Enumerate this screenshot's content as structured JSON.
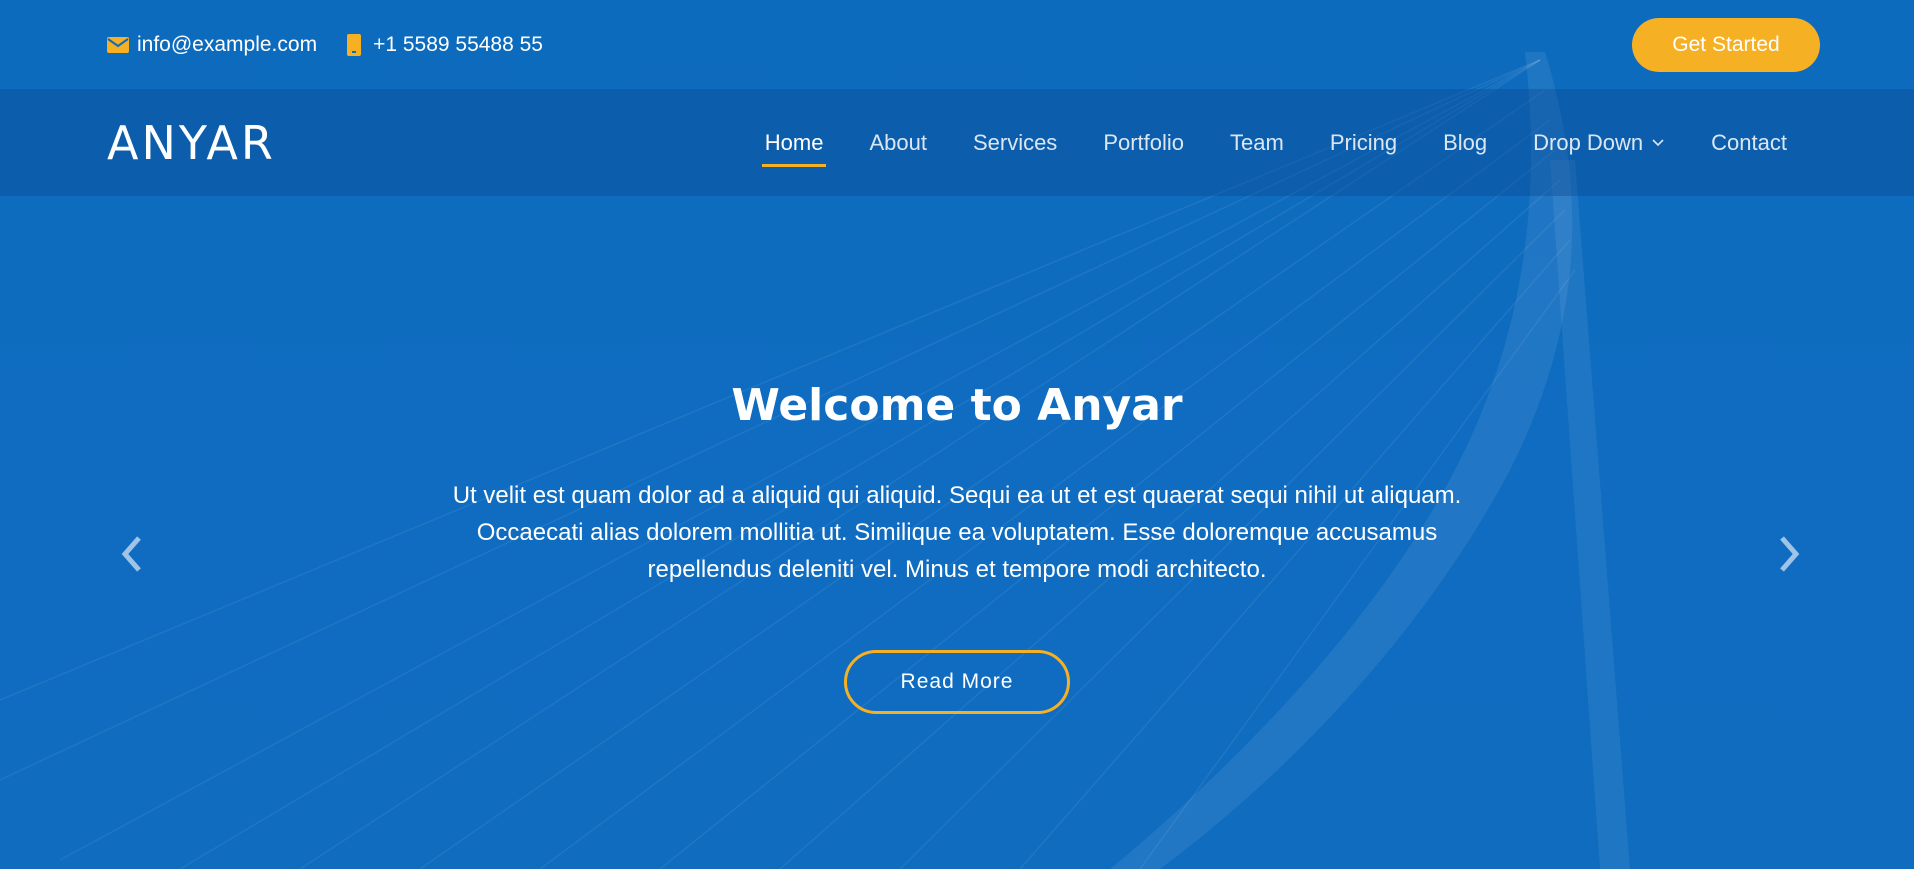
{
  "topbar": {
    "email": "info@example.com",
    "phone": "+1 5589 55488 55",
    "cta_label": "Get Started"
  },
  "header": {
    "logo": "ANYAR",
    "nav": [
      {
        "label": "Home",
        "active": true
      },
      {
        "label": "About"
      },
      {
        "label": "Services"
      },
      {
        "label": "Portfolio"
      },
      {
        "label": "Team"
      },
      {
        "label": "Pricing"
      },
      {
        "label": "Blog"
      },
      {
        "label": "Drop Down",
        "dropdown": true
      },
      {
        "label": "Contact"
      }
    ]
  },
  "hero": {
    "title": "Welcome to Anyar",
    "description": "Ut velit est quam dolor ad a aliquid qui aliquid. Sequi ea ut et est quaerat sequi nihil ut aliquam. Occaecati alias dolorem mollitia ut. Similique ea voluptatem. Esse doloremque accusamus repellendus deleniti vel. Minus et tempore modi architecto.",
    "button_label": "Read More"
  },
  "icons": {
    "email": "envelope-icon",
    "phone": "phone-icon",
    "prev": "chevron-left-icon",
    "next": "chevron-right-icon",
    "dropdown": "chevron-down-icon"
  },
  "colors": {
    "primary": "#0d6bbd",
    "accent": "#f6b024",
    "text": "#ffffff"
  }
}
